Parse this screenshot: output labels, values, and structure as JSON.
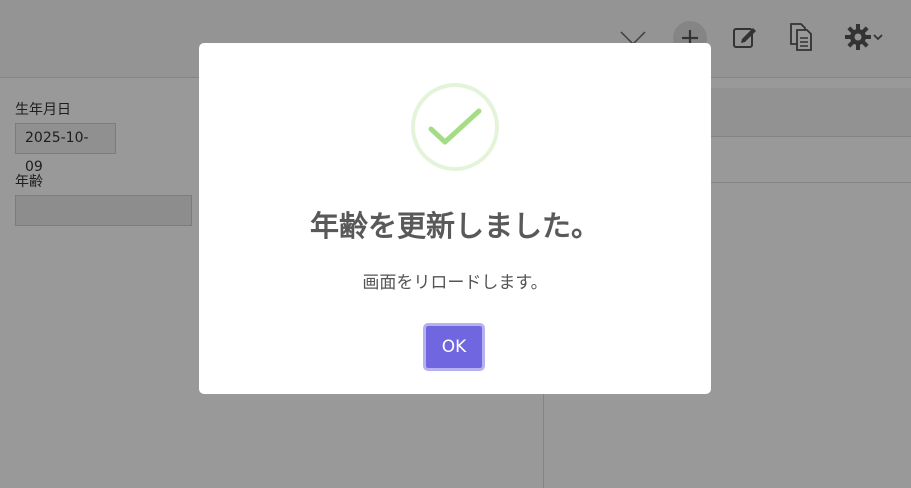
{
  "form": {
    "birthdate_label": "生年月日",
    "birthdate_value": "2025-10-09",
    "age_label": "年齢",
    "age_value": ""
  },
  "toolbar": {
    "icons": [
      "chevron-down-icon",
      "plus-icon",
      "edit-icon",
      "document-icon",
      "gear-icon"
    ]
  },
  "dialog": {
    "icon": "check-icon",
    "title": "年齢を更新しました。",
    "message": "画面をリロードします。",
    "ok_label": "OK"
  },
  "colors": {
    "confirm_button": "#7066e0",
    "success_check": "#a5dc86",
    "overlay": "rgba(0,0,0,0.4)"
  }
}
